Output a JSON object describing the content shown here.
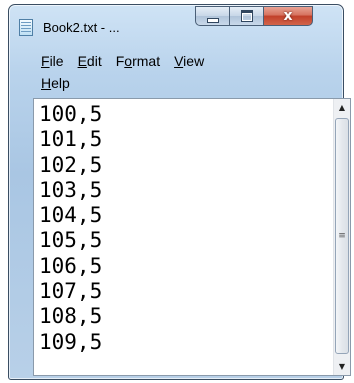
{
  "window": {
    "title": "Book2.txt - ...",
    "close_glyph": "x"
  },
  "menu": {
    "items": [
      "File",
      "Edit",
      "Format",
      "View",
      "Help"
    ],
    "mnemonics": [
      "F",
      "E",
      "o",
      "V",
      "H"
    ]
  },
  "editor": {
    "lines": [
      "100,5",
      "101,5",
      "102,5",
      "103,5",
      "104,5",
      "105,5",
      "106,5",
      "107,5",
      "108,5",
      "109,5"
    ]
  },
  "scrollbar": {
    "up_glyph": "▲",
    "down_glyph": "▼",
    "grip_glyph": "≡"
  }
}
